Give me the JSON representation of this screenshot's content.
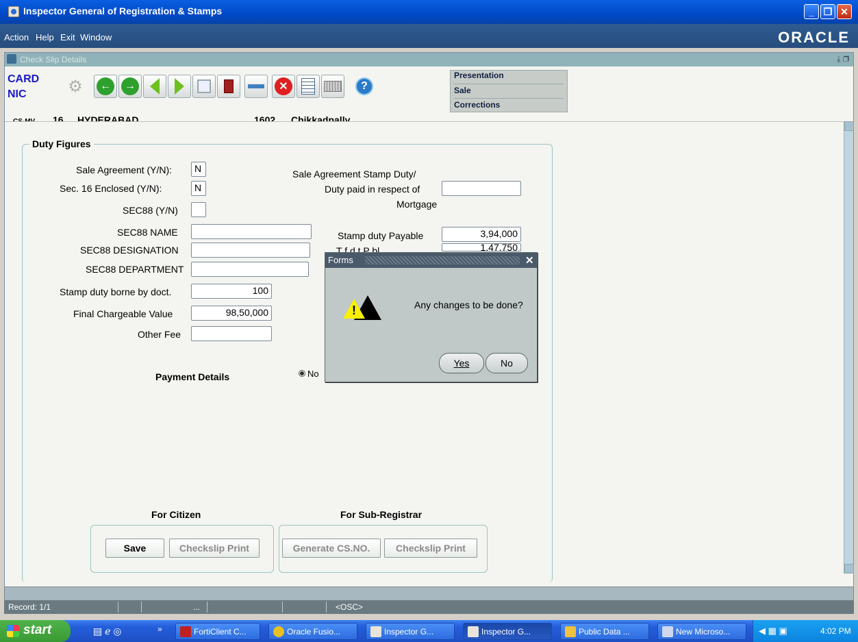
{
  "window": {
    "title": "Inspector General of Registration & Stamps",
    "brand": "ORACLE"
  },
  "menu": [
    "Action",
    "Help",
    "Exit",
    "Window"
  ],
  "inner_window": {
    "title": "Check Slip Details"
  },
  "header": {
    "card_label_1": "CARD",
    "card_label_2": "NIC",
    "mode": "CS-MV",
    "district_code": "16",
    "district_name": "HYDERABAD",
    "sro_code": "1602",
    "sro_name": "Chikkadpally",
    "nav_items": [
      "Presentation",
      "Sale",
      "Corrections"
    ]
  },
  "duty_figures": {
    "legend": "Duty Figures",
    "sale_agreement_label": "Sale Agreement (Y/N):",
    "sale_agreement_value": "N",
    "sec16_label": "Sec. 16 Enclosed (Y/N):",
    "sec16_value": "N",
    "sec88_label": "SEC88 (Y/N)",
    "sec88_value": "",
    "sec88_name_label": "SEC88 NAME",
    "sec88_designation_label": "SEC88 DESIGNATION",
    "sec88_department_label": "SEC88 DEPARTMENT",
    "stamp_duty_borne_label": "Stamp duty borne by doct.",
    "stamp_duty_borne_value": "100",
    "final_chargeable_label": "Final Chargeable Value",
    "final_chargeable_value": "98,50,000",
    "other_fee_label": "Other Fee",
    "other_fee_value": "",
    "sale_agreement_stamp_label_1": "Sale Agreement Stamp Duty/",
    "sale_agreement_stamp_label_2": "Duty paid in respect of",
    "sale_agreement_stamp_label_3": "Mortgage",
    "sale_agreement_stamp_value": "",
    "stamp_duty_payable_label": "Stamp duty Payable",
    "stamp_duty_payable_value": "3,94,000",
    "transfer_duty_label_partial": "T        f    d  t  P   bl",
    "transfer_duty_value_partial": "1,47,750",
    "payment_details_label": "Payment Details",
    "payment_radio_label": "No"
  },
  "actions": {
    "citizen_title": "For Citizen",
    "subregistrar_title": "For Sub-Registrar",
    "save": "Save",
    "checkslip_print_citizen": "Checkslip Print",
    "generate_cs_no": "Generate CS.NO.",
    "checkslip_print_sr": "Checkslip Print"
  },
  "dialog": {
    "title": "Forms",
    "message": "Any changes to be done?",
    "yes": "Yes",
    "no": "No"
  },
  "status": {
    "record": "Record: 1/1",
    "dots": "...",
    "osc": "<OSC>"
  },
  "taskbar": {
    "start": "start",
    "tasks": [
      "FortiClient C...",
      "Oracle Fusio...",
      "Inspector G...",
      "Inspector G...",
      "Public Data ...",
      "New Microso..."
    ],
    "clock": "4:02 PM"
  }
}
